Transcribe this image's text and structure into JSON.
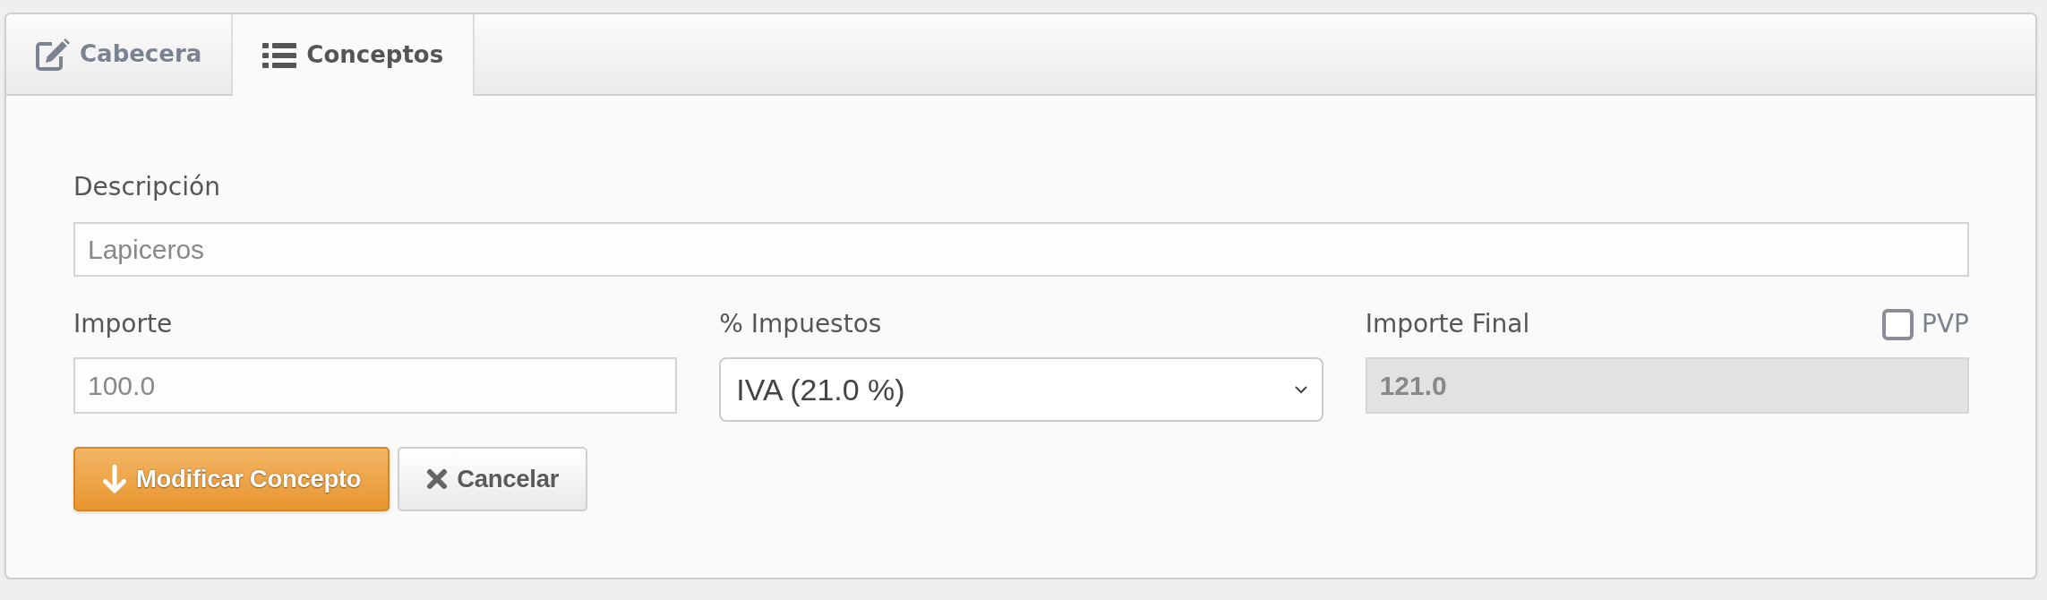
{
  "tabs": [
    {
      "label": "Cabecera",
      "selected": false
    },
    {
      "label": "Conceptos",
      "selected": true
    }
  ],
  "description": {
    "label": "Descripción",
    "value": "Lapiceros"
  },
  "amount": {
    "label": "Importe",
    "value": "100.0"
  },
  "tax": {
    "label": "% Impuestos",
    "value": "IVA (21.0 %)"
  },
  "final_amount": {
    "label": "Importe Final",
    "value": "121.0",
    "disabled": true
  },
  "pvp": {
    "label": "PVP",
    "checked": false
  },
  "buttons": [
    {
      "label": "Modificar Concepto",
      "kind": "primary"
    },
    {
      "label": "Cancelar",
      "kind": "cancel"
    }
  ]
}
